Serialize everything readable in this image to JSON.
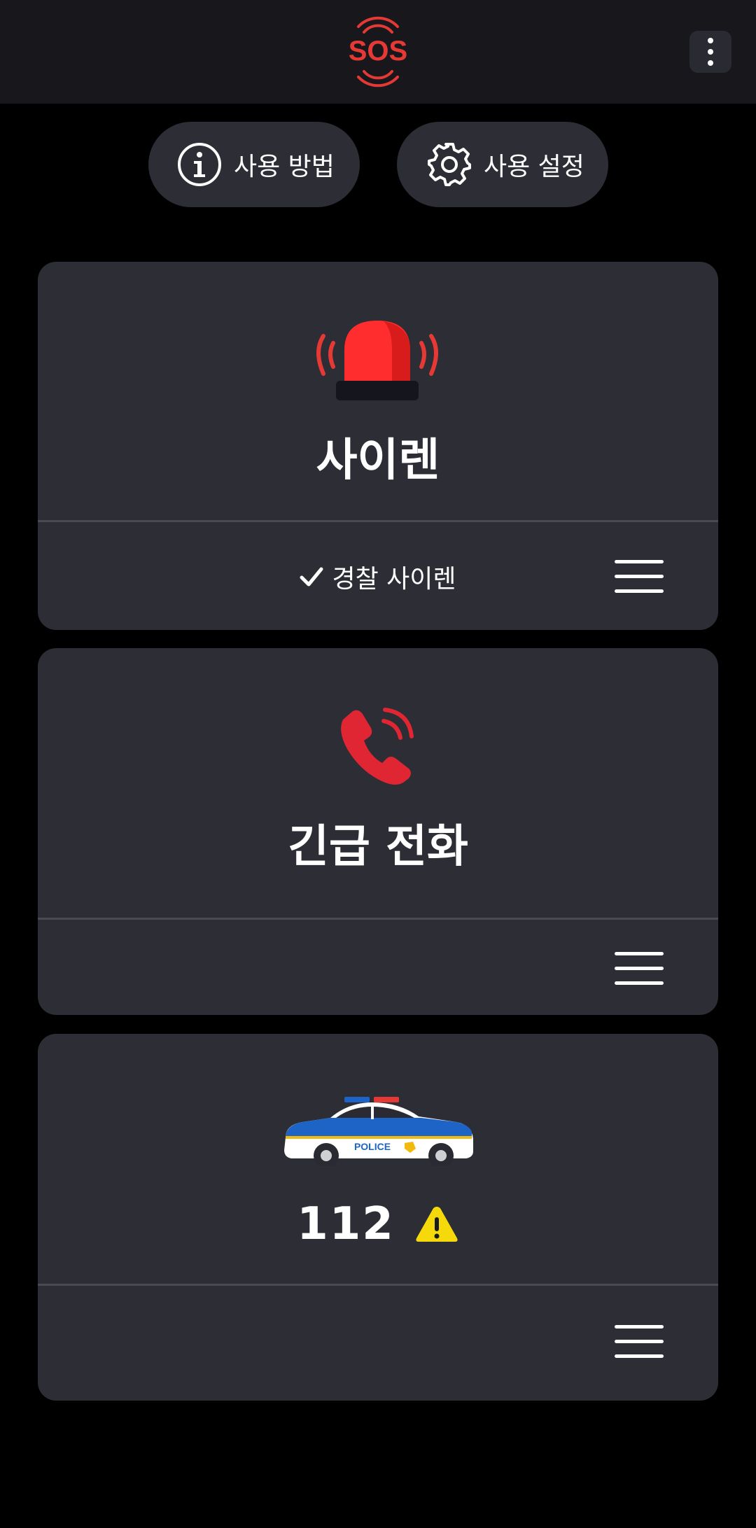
{
  "app": {
    "logo_text": "SOS",
    "accent_color": "#e53935"
  },
  "header_buttons": {
    "help_label": "사용 방법",
    "settings_label": "사용 설정"
  },
  "cards": {
    "siren": {
      "title": "사이렌",
      "selected": "경찰 사이렌",
      "icon": "siren-icon"
    },
    "emergency_call": {
      "title": "긴급 전화",
      "icon": "phone-ringing-icon"
    },
    "police": {
      "number": "112",
      "icon": "police-car-icon",
      "status_icon": "warning-icon",
      "car_text": "POLICE"
    }
  }
}
